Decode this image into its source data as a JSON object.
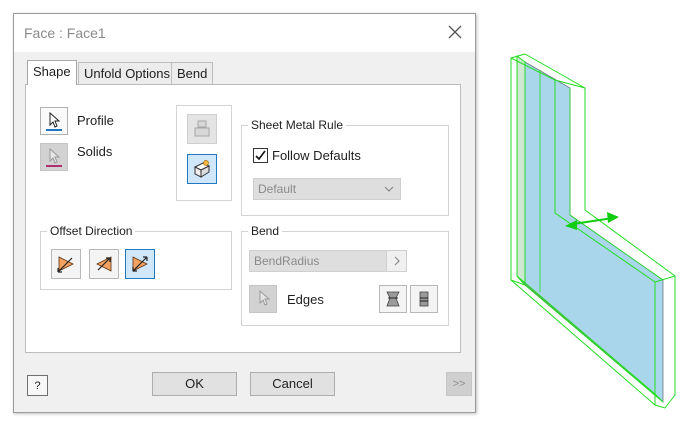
{
  "dialog": {
    "title": "Face : Face1"
  },
  "tabs": [
    {
      "label": "Shape",
      "active": true
    },
    {
      "label": "Unfold Options",
      "active": false
    },
    {
      "label": "Bend",
      "active": false
    }
  ],
  "shape": {
    "profile_label": "Profile",
    "solids_label": "Solids",
    "offset_direction_title": "Offset Direction",
    "sheet_metal_rule_title": "Sheet Metal Rule",
    "follow_defaults_label": "Follow Defaults",
    "follow_defaults_checked": true,
    "rule_value": "Default",
    "bend_title": "Bend",
    "bend_radius_value": "BendRadius",
    "edges_label": "Edges"
  },
  "footer": {
    "ok_label": "OK",
    "cancel_label": "Cancel",
    "more_label": ">>",
    "help_glyph": "?"
  },
  "colors": {
    "accent": "#1f78c1",
    "face_fill": "#add8e6",
    "edge_highlight": "#22dd22",
    "arrow_orange": "#f4a261"
  }
}
